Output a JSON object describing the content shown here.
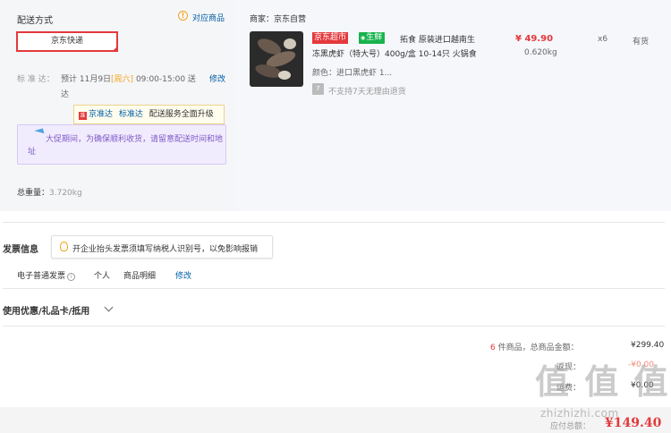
{
  "delivery": {
    "section_title": "配送方式",
    "related_goods_link": "对应商品",
    "method": "京东快递",
    "eta_label": "标 准 达：",
    "eta_value_pre": "预计 11月9日",
    "eta_weekday": "[周六]",
    "eta_value_post": "09:00-15:00 送",
    "eta_value_line2": "达",
    "edit_link": "修改",
    "upgrade_tip": {
      "brand": "京准达",
      "brand2": "标准达",
      "text": "配送服务全面升级"
    },
    "promo_text": "大促期间，为确保顺利收货，请留意配送时间和地址",
    "total_weight_label": "总重量：",
    "total_weight_value": "3.720kg"
  },
  "shop": {
    "label": "商家：京东自营",
    "product": {
      "tag_market": "京东超市",
      "tag_fresh": "生鲜",
      "title_line1": "拓食 原装进口越南生",
      "title_line2": "冻黑虎虾（特大号）400g/盒 10-14只 火锅食",
      "color_label": "颜色：进口黑虎虾 1...",
      "no_return": "不支持7天无理由退货",
      "price": "¥ 49.90",
      "weight": "0.620kg",
      "qty": "x6",
      "stock": "有货"
    }
  },
  "invoice": {
    "title": "发票信息",
    "tip": "开企业抬头发票须填写纳税人识别号，以免影响报销",
    "type": "电子普通发票",
    "info_icon": "i",
    "payer": "个人",
    "detail": "商品明细",
    "edit_link": "修改"
  },
  "coupons": {
    "title": "使用优惠/礼品卡/抵用"
  },
  "summary": {
    "count": "6",
    "count_text": " 件商品，总商品金额：",
    "total_goods": "¥299.40",
    "row2_label": "返现：",
    "row2_value": "-¥0.00",
    "row3_label": "运费：",
    "row3_value": "¥0.00",
    "pay_label": "应付总额：",
    "pay_value": "¥149.40"
  },
  "watermark": {
    "chars": "值 值 值",
    "url": "zhizhizhi.com"
  },
  "colors": {
    "accent_red": "#e4393c",
    "link_blue": "#005ea7",
    "warning_orange": "#f3a21a",
    "fresh_green": "#18b34e",
    "promo_purple": "#7f5ac6"
  },
  "icons": [
    "warning-icon",
    "bulb-icon",
    "info-icon",
    "chevron-down-icon",
    "no-return-icon",
    "jzd-icon",
    "promo-plane-icon"
  ]
}
